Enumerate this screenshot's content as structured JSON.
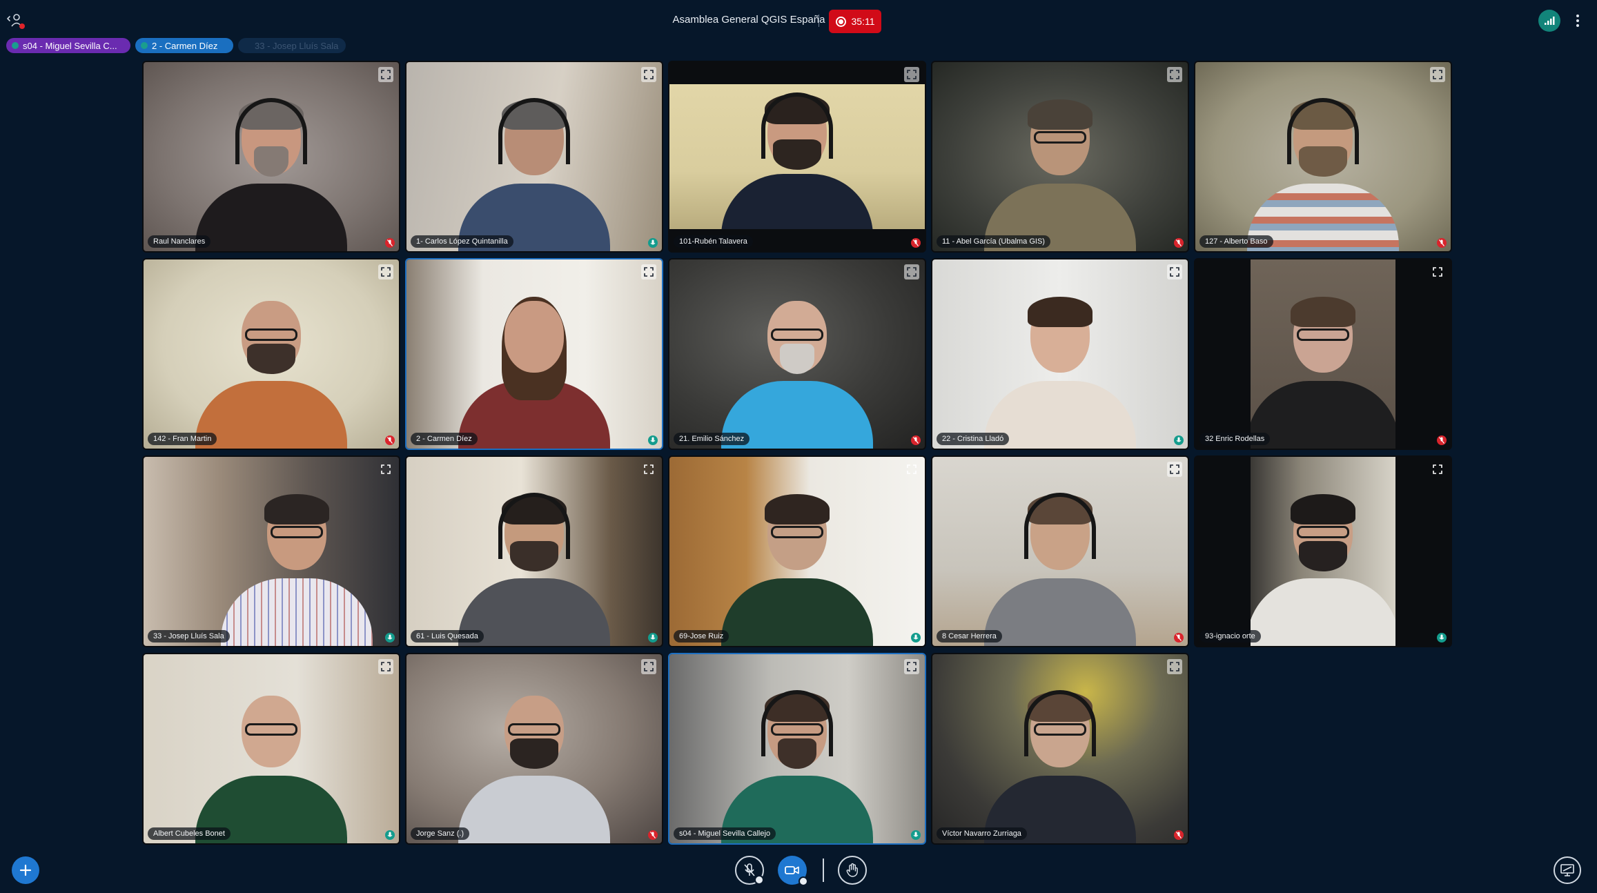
{
  "header": {
    "meeting_title": "Asamblea General QGIS España",
    "recording_time": "35:11",
    "colors": {
      "background": "#06172a",
      "record": "#d10b18",
      "accent": "#1f78d1",
      "connection": "#12847a"
    }
  },
  "talkers": [
    {
      "label": "s04 - Miguel Sevilla C...",
      "state": "talking"
    },
    {
      "label": "2 - Carmen Díez",
      "state": "talking"
    },
    {
      "label": "33 - Josep Lluís Sala",
      "state": "faded"
    }
  ],
  "tiles": [
    {
      "name": "Raul Nanclares",
      "mic": "muted",
      "talking": false
    },
    {
      "name": "1- Carlos López Quintanilla",
      "mic": "unmuted",
      "talking": false
    },
    {
      "name": "101-Rubén Talavera",
      "mic": "muted",
      "talking": false
    },
    {
      "name": "11 - Abel García (Ubalma GIS)",
      "mic": "muted",
      "talking": false
    },
    {
      "name": "127 - Alberto Baso",
      "mic": "muted",
      "talking": false
    },
    {
      "name": "142 - Fran Martin",
      "mic": "muted",
      "talking": false
    },
    {
      "name": "2 - Carmen Díez",
      "mic": "unmuted",
      "talking": true
    },
    {
      "name": "21. Emilio Sánchez",
      "mic": "muted",
      "talking": false
    },
    {
      "name": "22 - Cristina Lladó",
      "mic": "unmuted",
      "talking": false
    },
    {
      "name": "32 Enric Rodellas",
      "mic": "muted",
      "talking": false
    },
    {
      "name": "33 - Josep Lluís Sala",
      "mic": "unmuted",
      "talking": false
    },
    {
      "name": "61 - Luis Quesada",
      "mic": "unmuted",
      "talking": false
    },
    {
      "name": "69-Jose Ruiz",
      "mic": "unmuted",
      "talking": false
    },
    {
      "name": "8 Cesar Herrera",
      "mic": "muted",
      "talking": false
    },
    {
      "name": "93-ignacio orte",
      "mic": "unmuted",
      "talking": false
    },
    {
      "name": "Albert Cubeles Bonet",
      "mic": "unmuted",
      "talking": false
    },
    {
      "name": "Jorge Sanz (.)",
      "mic": "muted",
      "talking": false
    },
    {
      "name": "s04 - Miguel Sevilla Callejo",
      "mic": "unmuted",
      "talking": true
    },
    {
      "name": "Víctor Navarro Zurriaga",
      "mic": "muted",
      "talking": false
    }
  ],
  "icons": {
    "user_list": "user-list-icon",
    "connection": "connection-status-icon",
    "more": "more-options-icon",
    "expand": "expand-icon",
    "add": "plus-icon",
    "mic": "microphone-muted-icon",
    "camera": "camera-icon",
    "hand": "raise-hand-icon",
    "present": "presentation-icon"
  }
}
